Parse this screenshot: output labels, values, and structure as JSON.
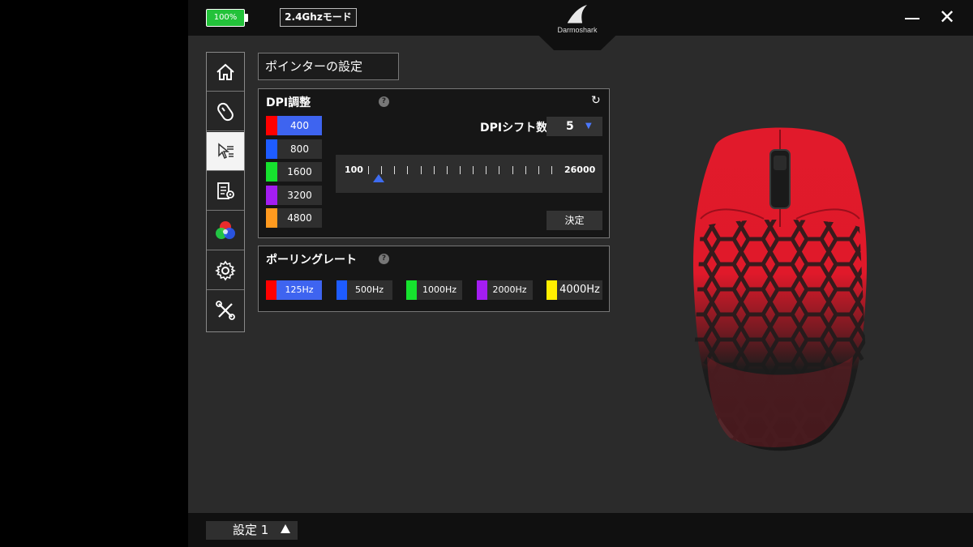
{
  "titlebar": {
    "battery_label": "100%",
    "battery_color": "#23c23a",
    "mode_label": "2.4Ghzモード",
    "brand": "Darmoshark",
    "minimize_icon": "minimize-icon",
    "close_icon": "close-icon",
    "close_glyph": "✕"
  },
  "nav": {
    "items": [
      {
        "name": "home",
        "icon": "home-icon"
      },
      {
        "name": "buttons",
        "icon": "mouse-icon"
      },
      {
        "name": "pointer",
        "icon": "pointer-settings-icon",
        "active": true
      },
      {
        "name": "macro",
        "icon": "macro-icon"
      },
      {
        "name": "lighting",
        "icon": "rgb-icon"
      },
      {
        "name": "settings",
        "icon": "gear-icon"
      },
      {
        "name": "tools",
        "icon": "tools-icon"
      }
    ]
  },
  "page": {
    "title": "ポインターの設定"
  },
  "dpi": {
    "title": "DPI調整",
    "help": "?",
    "reset_icon": "reset-icon",
    "reset_glyph": "↻",
    "slots": [
      {
        "value": "400",
        "color": "#ff0000",
        "selected": true
      },
      {
        "value": "800",
        "color": "#1e5cff",
        "selected": false
      },
      {
        "value": "1600",
        "color": "#16e22e",
        "selected": false
      },
      {
        "value": "3200",
        "color": "#a41df2",
        "selected": false
      },
      {
        "value": "4800",
        "color": "#ff9a1f",
        "selected": false
      }
    ],
    "shift_label": "DPIシフト数",
    "shift_value": "5",
    "shift_arrow": "▼",
    "slider": {
      "min_label": "100",
      "max_label": "26000",
      "tick_count": 15,
      "value": 400,
      "min": 100,
      "max": 26000
    },
    "apply_label": "決定"
  },
  "polling": {
    "title": "ポーリングレート",
    "help": "?",
    "options": [
      {
        "value": "125Hz",
        "color": "#ff0000",
        "selected": true
      },
      {
        "value": "500Hz",
        "color": "#1e5cff",
        "selected": false
      },
      {
        "value": "1000Hz",
        "color": "#16e22e",
        "selected": false
      },
      {
        "value": "2000Hz",
        "color": "#a41df2",
        "selected": false
      },
      {
        "value": "4000Hz",
        "color": "#ffee00",
        "selected": false
      }
    ]
  },
  "bottom": {
    "profile_label": "設定 1"
  }
}
